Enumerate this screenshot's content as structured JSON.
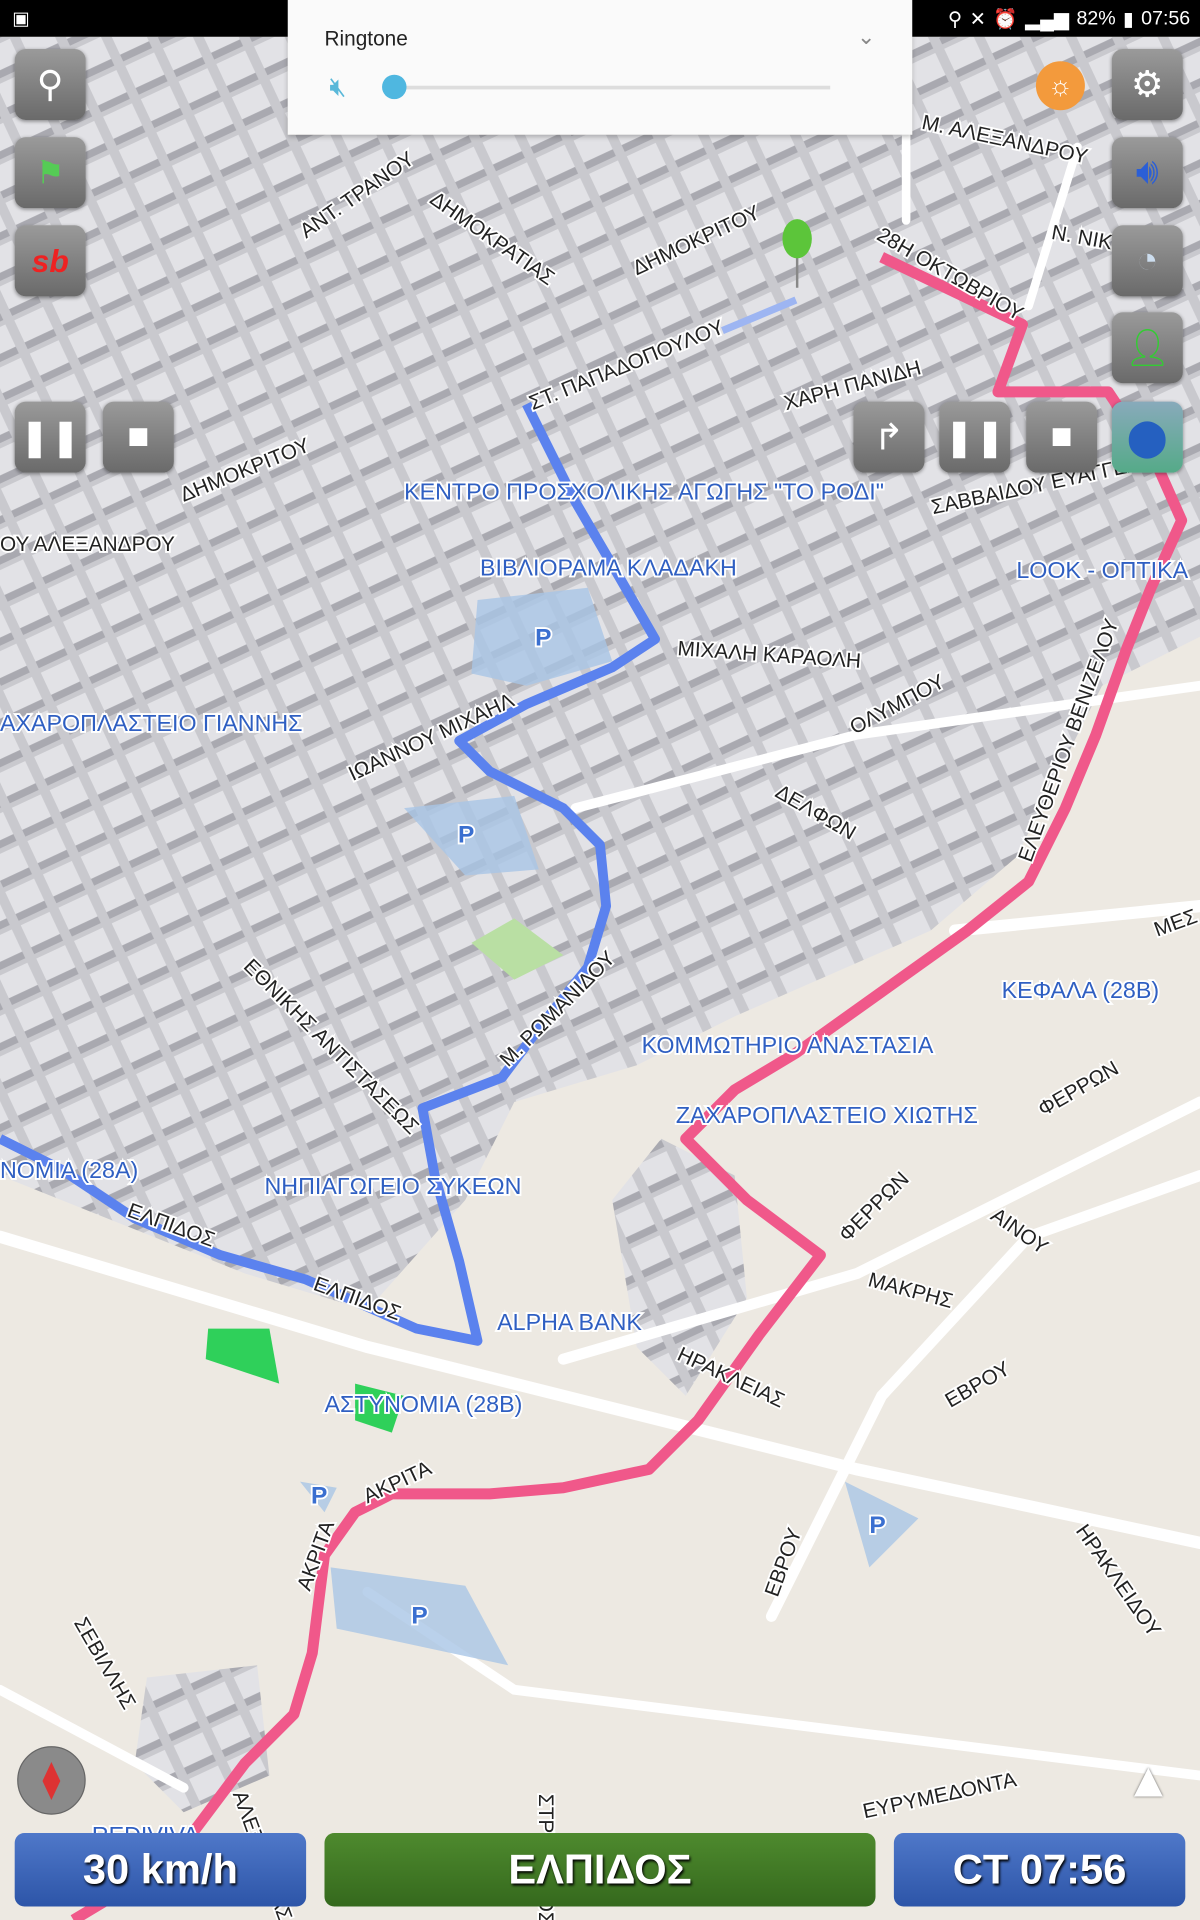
{
  "status_bar": {
    "time": "07:56",
    "battery": "82%",
    "icons": [
      "image-icon",
      "location-icon",
      "vibrate-icon",
      "alarm-icon",
      "signal-icon",
      "battery-icon"
    ]
  },
  "volume_panel": {
    "title": "Ringtone",
    "level": 0,
    "icons": [
      "mute-icon",
      "chevron-down-icon"
    ]
  },
  "left_buttons": [
    "search-icon",
    "route-flag-icon",
    "sb-logo-icon"
  ],
  "right_buttons": [
    "settings-icon",
    "speaker-icon",
    "speedometer-icon",
    "person-icon",
    "lightbulb-icon"
  ],
  "playback": {
    "left": [
      "pause-icon",
      "stop-icon"
    ],
    "right": [
      "turn-arrow-icon",
      "pause-icon",
      "stop-icon",
      "map-thumbnail"
    ]
  },
  "bottom_bar": {
    "speed": "30 km/h",
    "street": "ΕΛΠΙΔΟΣ",
    "time": "CT 07:56"
  },
  "colors": {
    "route_blue": "#5b82ee",
    "route_pink": "#f0588a",
    "poi_blue": "#2f5fc2",
    "bar_blue": "#3a62b8",
    "bar_green": "#437d26"
  },
  "map": {
    "labels": [
      "Μ. ΑΛΕΞΑΝΔΡΟΥ",
      "Ν. ΝΙΚΗ",
      "28Η ΟΚΤΩΒΡΙΟΥ",
      "ΑΝΤ. ΤΡΑΝΟΥ",
      "ΔΗΜΟΚΡΑΤΙΑΣ",
      "ΔΗΜΟΚΡΙΤΟΥ",
      "ΣΤ. ΠΑΠΑΔΟΠΟΥΛΟΥ",
      "ΧΑΡΗ ΠΑΝΙΔΗ",
      "ΔΗΜΟΚΡΙΤΟΥ",
      "ΣΑΒΒΑΙΔΟΥ ΕΥΑΓΓΕΛΟΥ",
      "ΟΥ ΑΛΕΞΑΝΔΡΟΥ",
      "ΜΙΧΑΛΗ ΚΑΡΑΟΛΗ",
      "ΟΛΥΜΠΟΥ",
      "ΙΩΑΝΝΟΥ ΜΙΧΑΗΛ",
      "ΔΕΛΦΩΝ",
      "ΕΛΕΥΘΕΡΙΟΥ ΒΕΝΙΖΕΛΟΥ",
      "ΜΕΣ",
      "ΕΘΝΙΚΗΣ ΑΝΤΙΣΤΑΣΕΩΣ",
      "Μ. ΡΩΜΑΝΙΔΟΥ",
      "ΦΕΡΡΩΝ",
      "ΕΛΠΙΔΟΣ",
      "ΦΕΡΡΩΝ",
      "ΑΙΝΟΥ",
      "ΕΛΠΙΔΟΣ",
      "ΜΑΚΡΗΣ",
      "ΗΡΑΚΛΕΙΑΣ",
      "ΕΒΡΟΥ",
      "ΑΚΡΙΤΑ",
      "ΑΚΡΙΤΑ",
      "ΕΒΡΟΥ",
      "ΗΡΑΚΛΕΙΔΟΥ",
      "ΣΕΒΙΛΛΗΣ",
      "ΕΥΡΥΜΕΔΟΝΤΑ",
      "ΑΛΕΞΑΝΔΡΑΣ",
      "ΣΤΡΥΜΟΝΟΣ"
    ],
    "pois": [
      "ΚΕΝΤΡΟ ΠΡΟΣΧΟΛΙΚΗΣ ΑΓΩΓΗΣ \"ΤΟ ΡΟΔΙ\"",
      "ΒΙΒΛΙΟΡΑΜΑ ΚΛΑΔΑΚΗ",
      "LOOK - ΟΠΤΙΚΑ",
      "ΑΧΑΡΟΠΛΑΣΤΕΙΟ ΓΙΑΝΝΗΣ",
      "ΚΕΦΑΛΑ (28Β)",
      "ΚΟΜΜΩΤΗΡΙΟ ΑΝΑΣΤΑΣΙΑ",
      "ΖΑΧΑΡΟΠΛΑΣΤΕΙΟ ΧΙΩΤΗΣ",
      "ΝΗΠΙΑΓΩΓΕΙΟ ΣΥΚΕΩΝ",
      "ΝΟΜΙΑ (28Α)",
      "ALPHA BANK",
      "ΑΣΤΥΝΟΜΙΑ (28Β)",
      "REDIVIVA"
    ],
    "parking": "P"
  }
}
